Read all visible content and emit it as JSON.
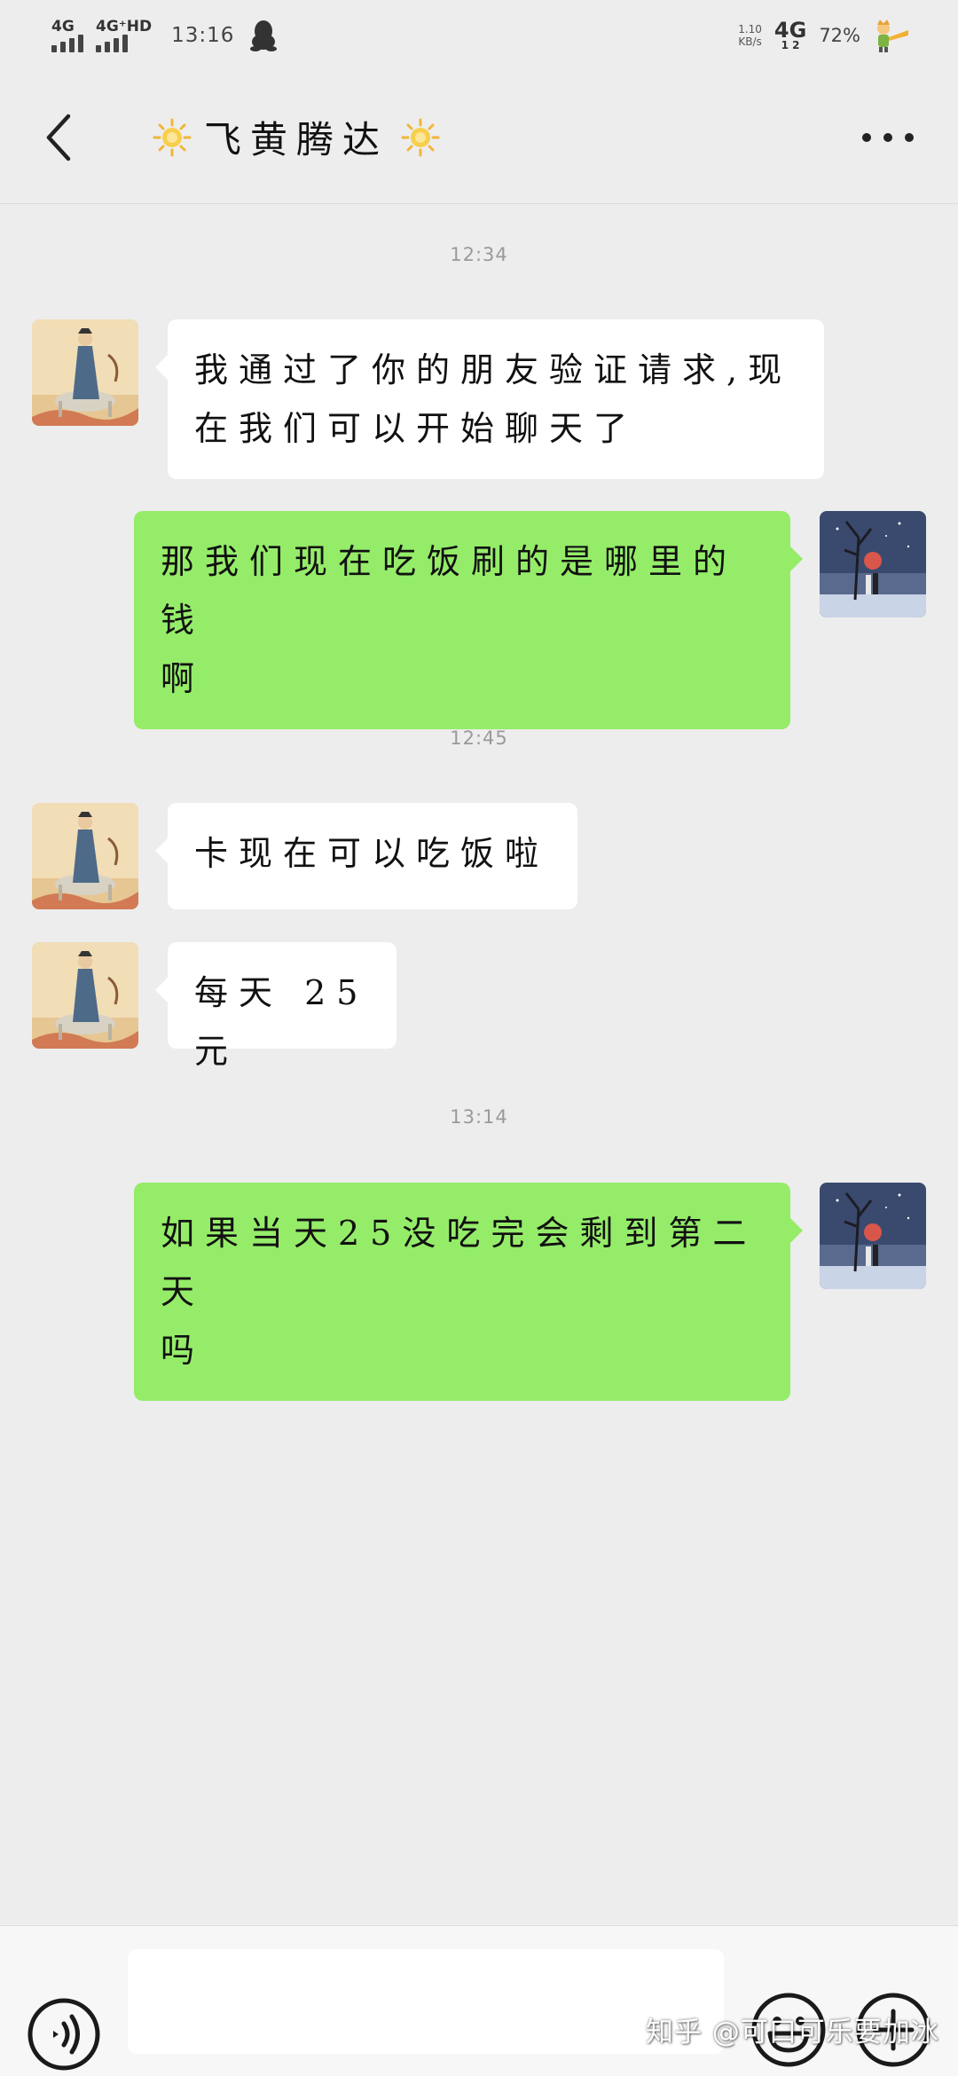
{
  "status_bar": {
    "sim1_label": "4G",
    "sim2_label": "4G⁺HD",
    "time": "13:16",
    "speed_value": "1.10",
    "speed_unit": "KB/s",
    "network": "4G",
    "network_sub": "1 2",
    "battery": "72%"
  },
  "header": {
    "title": "飞黄腾达",
    "title_icon": "sun-emoji",
    "back_icon": "chevron-left-icon",
    "more_icon": "more-dots-icon"
  },
  "messages": [
    {
      "type": "time",
      "text": "12:34"
    },
    {
      "type": "incoming",
      "lines": [
        "我通过了你的朋友验证请求,现",
        "在我们可以开始聊天了"
      ]
    },
    {
      "type": "outgoing",
      "lines": [
        "那我们现在吃饭刷的是哪里的钱",
        "啊"
      ]
    },
    {
      "type": "time",
      "text": "12:45"
    },
    {
      "type": "incoming",
      "lines": [
        "卡现在可以吃饭啦"
      ]
    },
    {
      "type": "incoming",
      "lines": [
        "每天 25 元"
      ]
    },
    {
      "type": "time",
      "text": "13:14"
    },
    {
      "type": "outgoing",
      "lines": [
        "如果当天25没吃完会剩到第二天",
        "吗"
      ]
    }
  ],
  "input_bar": {
    "voice_icon": "voice-icon",
    "text_value": "",
    "emoji_icon": "emoji-icon",
    "plus_icon": "plus-icon"
  },
  "watermark": "知乎 @可口可乐要加冰",
  "colors": {
    "background": "#ededed",
    "outgoing_bubble": "#95ec69",
    "incoming_bubble": "#ffffff",
    "timestamp_text": "#9a9a9a"
  }
}
